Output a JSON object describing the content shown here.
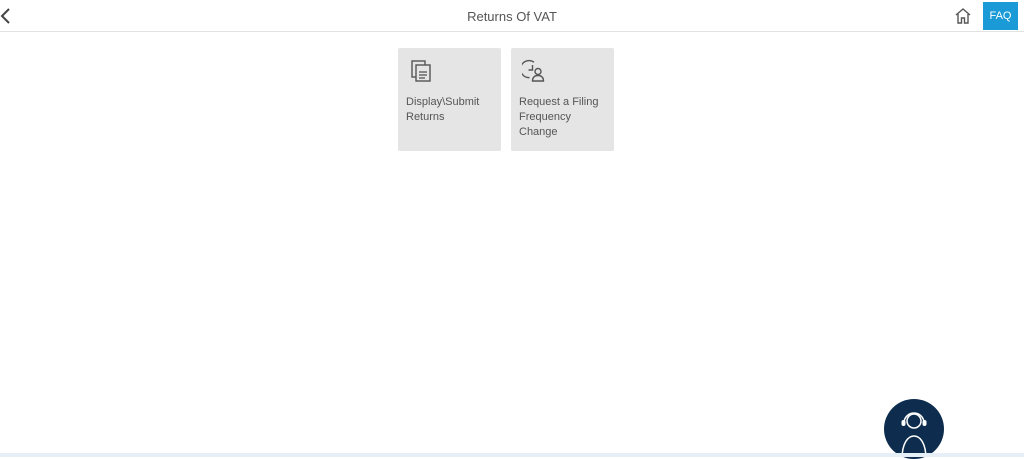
{
  "header": {
    "title": "Returns Of VAT",
    "back_icon": "chevron-left-icon",
    "home_icon": "home-icon",
    "faq_label": "FAQ",
    "faq_color": "#1a9ad6"
  },
  "tiles": [
    {
      "label": "Display\\Submit Returns",
      "icon": "documents-icon"
    },
    {
      "label": "Request a Filing Frequency Change",
      "icon": "clock-user-icon"
    }
  ],
  "assistant": {
    "icon": "support-agent-icon",
    "color": "#0e2d4e"
  }
}
